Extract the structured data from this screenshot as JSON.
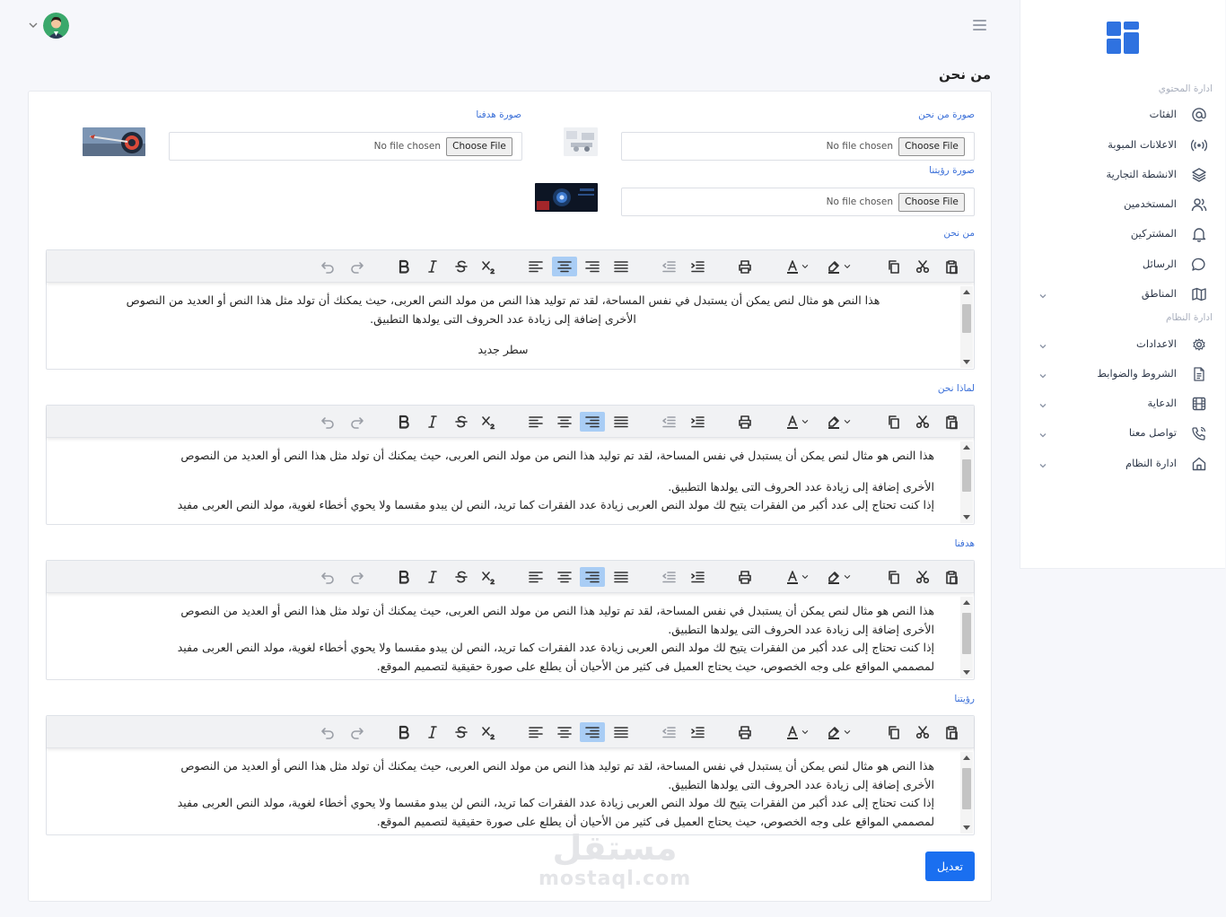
{
  "page": {
    "title": "من نحن"
  },
  "sidebar": {
    "section_content": "ادارة المحتوي",
    "section_system": "ادارة النظام",
    "items": [
      {
        "label": "الفئات",
        "icon": "at-icon"
      },
      {
        "label": "الاعلانات المبوبة",
        "icon": "broadcast-icon"
      },
      {
        "label": "الانشطة التجارية",
        "icon": "layers-icon"
      },
      {
        "label": "المستخدمين",
        "icon": "users-icon"
      },
      {
        "label": "المشتركين",
        "icon": "bell-icon"
      },
      {
        "label": "الرسائل",
        "icon": "chat-icon"
      },
      {
        "label": "المناطق",
        "icon": "map-icon"
      },
      {
        "label": "الاعدادات",
        "icon": "gear-icon"
      },
      {
        "label": "الشروط والضوابط",
        "icon": "document-icon"
      },
      {
        "label": "الدعاية",
        "icon": "film-icon"
      },
      {
        "label": "تواصل معنا",
        "icon": "phone-icon"
      },
      {
        "label": "ادارة النظام",
        "icon": "home-icon"
      }
    ]
  },
  "images": {
    "about_label": "صورة من نحن",
    "goal_label": "صورة هدفنا",
    "vision_label": "صورة رؤيتنا",
    "no_file": "No file chosen",
    "choose_file": "Choose File"
  },
  "editors": [
    {
      "label": "من نحن",
      "align": "center",
      "lines": [
        "هذا النص هو مثال لنص يمكن أن يستبدل في نفس المساحة، لقد تم توليد هذا النص من مولد النص العربى، حيث يمكنك أن تولد مثل هذا النص أو العديد من النصوص",
        "الأخرى إضافة إلى زيادة عدد الحروف التى يولدها التطبيق.",
        "",
        "سطر جديد"
      ]
    },
    {
      "label": "لماذا نحن",
      "align": "right",
      "lines": [
        "هذا النص هو مثال لنص يمكن أن يستبدل في نفس المساحة، لقد تم توليد هذا النص من مولد النص العربى، حيث يمكنك أن تولد مثل هذا النص أو العديد من النصوص",
        "",
        "الأخرى إضافة إلى زيادة عدد الحروف التى يولدها التطبيق.",
        "إذا كنت تحتاج إلى عدد أكبر من الفقرات يتيح لك مولد النص العربى زيادة عدد الفقرات كما تريد، النص لن يبدو مقسما ولا يحوي أخطاء لغوية، مولد النص العربى مفيد"
      ]
    },
    {
      "label": "هدفنا",
      "align": "right",
      "lines": [
        "هذا النص هو مثال لنص يمكن أن يستبدل في نفس المساحة، لقد تم توليد هذا النص من مولد النص العربى، حيث يمكنك أن تولد مثل هذا النص أو العديد من النصوص",
        "الأخرى إضافة إلى زيادة عدد الحروف التى يولدها التطبيق.",
        "إذا كنت تحتاج إلى عدد أكبر من الفقرات يتيح لك مولد النص العربى زيادة عدد الفقرات كما تريد، النص لن يبدو مقسما ولا يحوي أخطاء لغوية، مولد النص العربى مفيد",
        "لمصممي المواقع على وجه الخصوص، حيث يحتاج العميل فى كثير من الأحيان أن يطلع على صورة حقيقية لتصميم الموقع."
      ]
    },
    {
      "label": "رؤيتنا",
      "align": "right",
      "lines": [
        "هذا النص هو مثال لنص يمكن أن يستبدل في نفس المساحة، لقد تم توليد هذا النص من مولد النص العربى، حيث يمكنك أن تولد مثل هذا النص أو العديد من النصوص",
        "الأخرى إضافة إلى زيادة عدد الحروف التى يولدها التطبيق.",
        "إذا كنت تحتاج إلى عدد أكبر من الفقرات يتيح لك مولد النص العربى زيادة عدد الفقرات كما تريد، النص لن يبدو مقسما ولا يحوي أخطاء لغوية، مولد النص العربى مفيد",
        "لمصممي المواقع على وجه الخصوص، حيث يحتاج العميل فى كثير من الأحيان أن يطلع على صورة حقيقية لتصميم الموقع."
      ]
    }
  ],
  "submit_label": "تعديل",
  "watermark": {
    "arabic": "مستقل",
    "latin": "mostaql.com"
  },
  "colors": {
    "accent": "#1a6ff0",
    "label": "#3a6fd8",
    "active_tool": "#a9cdf5"
  }
}
